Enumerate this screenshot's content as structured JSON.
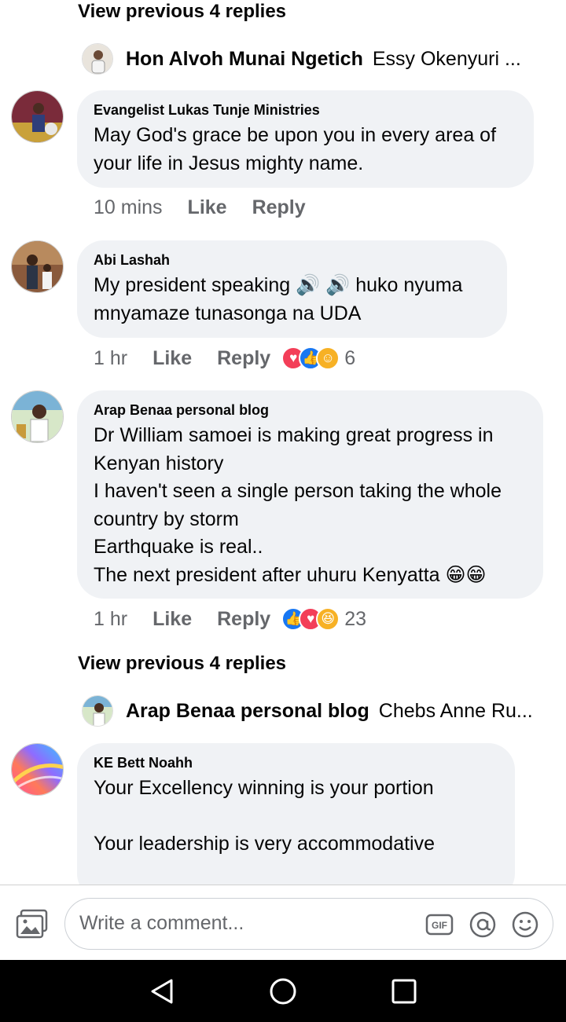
{
  "thread": {
    "view_previous_top": "View previous 4 replies",
    "reply_preview_top": {
      "name": "Hon Alvoh Munai Ngetich",
      "text": "Essy Okenyuri ..."
    },
    "view_previous_mid": "View previous 4 replies",
    "reply_preview_mid": {
      "name": "Arap Benaa personal blog",
      "text": "Chebs Anne Ru..."
    }
  },
  "comments": [
    {
      "author": "Evangelist  Lukas Tunje Ministries",
      "text": "May God's grace be upon you in every area of your life in Jesus mighty name.",
      "time": "10 mins",
      "like": "Like",
      "reply": "Reply"
    },
    {
      "author": "Abi Lashah",
      "text": "My president speaking 🔊 🔊 huko nyuma mnyamaze tunasonga na UDA",
      "time": "1 hr",
      "like": "Like",
      "reply": "Reply",
      "reaction_count": "6"
    },
    {
      "author": "Arap Benaa personal blog",
      "text": "Dr William samoei is making great progress in Kenyan history\nI haven't seen a single person taking the whole country by storm\nEarthquake is real..\nThe next president after uhuru Kenyatta 😁😁",
      "time": "1 hr",
      "like": "Like",
      "reply": "Reply",
      "reaction_count": "23"
    },
    {
      "author": "KE Bett Noahh",
      "text": "Your Excellency winning is your portion\n\nYour leadership is very accommodative"
    }
  ],
  "composer": {
    "placeholder": "Write a comment...",
    "gif_label": "GIF"
  },
  "colors": {
    "bubble": "#f0f2f5",
    "meta_text": "#65676b",
    "like_blue": "#1877f2",
    "love_red": "#f33e58",
    "haha_yellow": "#f7b125"
  },
  "icons": [
    "photo-icon",
    "gif-icon",
    "mention-icon",
    "emoji-icon",
    "nav-back-icon",
    "nav-home-icon",
    "nav-recents-icon",
    "like-reaction-icon",
    "love-reaction-icon",
    "care-reaction-icon",
    "haha-reaction-icon"
  ]
}
